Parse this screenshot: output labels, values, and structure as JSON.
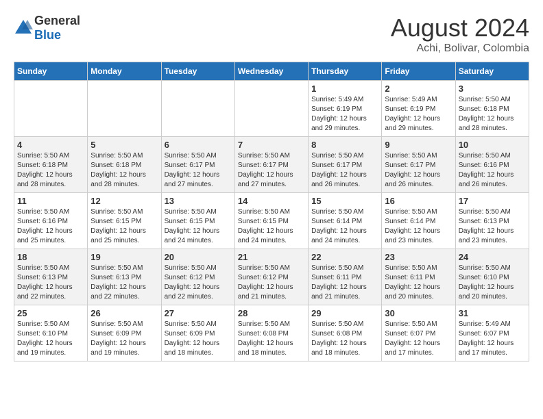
{
  "header": {
    "logo": {
      "general": "General",
      "blue": "Blue"
    },
    "month": "August 2024",
    "location": "Achi, Bolivar, Colombia"
  },
  "weekdays": [
    "Sunday",
    "Monday",
    "Tuesday",
    "Wednesday",
    "Thursday",
    "Friday",
    "Saturday"
  ],
  "weeks": [
    [
      {
        "day": "",
        "info": ""
      },
      {
        "day": "",
        "info": ""
      },
      {
        "day": "",
        "info": ""
      },
      {
        "day": "",
        "info": ""
      },
      {
        "day": "1",
        "info": "Sunrise: 5:49 AM\nSunset: 6:19 PM\nDaylight: 12 hours\nand 29 minutes."
      },
      {
        "day": "2",
        "info": "Sunrise: 5:49 AM\nSunset: 6:19 PM\nDaylight: 12 hours\nand 29 minutes."
      },
      {
        "day": "3",
        "info": "Sunrise: 5:50 AM\nSunset: 6:18 PM\nDaylight: 12 hours\nand 28 minutes."
      }
    ],
    [
      {
        "day": "4",
        "info": "Sunrise: 5:50 AM\nSunset: 6:18 PM\nDaylight: 12 hours\nand 28 minutes."
      },
      {
        "day": "5",
        "info": "Sunrise: 5:50 AM\nSunset: 6:18 PM\nDaylight: 12 hours\nand 28 minutes."
      },
      {
        "day": "6",
        "info": "Sunrise: 5:50 AM\nSunset: 6:17 PM\nDaylight: 12 hours\nand 27 minutes."
      },
      {
        "day": "7",
        "info": "Sunrise: 5:50 AM\nSunset: 6:17 PM\nDaylight: 12 hours\nand 27 minutes."
      },
      {
        "day": "8",
        "info": "Sunrise: 5:50 AM\nSunset: 6:17 PM\nDaylight: 12 hours\nand 26 minutes."
      },
      {
        "day": "9",
        "info": "Sunrise: 5:50 AM\nSunset: 6:17 PM\nDaylight: 12 hours\nand 26 minutes."
      },
      {
        "day": "10",
        "info": "Sunrise: 5:50 AM\nSunset: 6:16 PM\nDaylight: 12 hours\nand 26 minutes."
      }
    ],
    [
      {
        "day": "11",
        "info": "Sunrise: 5:50 AM\nSunset: 6:16 PM\nDaylight: 12 hours\nand 25 minutes."
      },
      {
        "day": "12",
        "info": "Sunrise: 5:50 AM\nSunset: 6:15 PM\nDaylight: 12 hours\nand 25 minutes."
      },
      {
        "day": "13",
        "info": "Sunrise: 5:50 AM\nSunset: 6:15 PM\nDaylight: 12 hours\nand 24 minutes."
      },
      {
        "day": "14",
        "info": "Sunrise: 5:50 AM\nSunset: 6:15 PM\nDaylight: 12 hours\nand 24 minutes."
      },
      {
        "day": "15",
        "info": "Sunrise: 5:50 AM\nSunset: 6:14 PM\nDaylight: 12 hours\nand 24 minutes."
      },
      {
        "day": "16",
        "info": "Sunrise: 5:50 AM\nSunset: 6:14 PM\nDaylight: 12 hours\nand 23 minutes."
      },
      {
        "day": "17",
        "info": "Sunrise: 5:50 AM\nSunset: 6:13 PM\nDaylight: 12 hours\nand 23 minutes."
      }
    ],
    [
      {
        "day": "18",
        "info": "Sunrise: 5:50 AM\nSunset: 6:13 PM\nDaylight: 12 hours\nand 22 minutes."
      },
      {
        "day": "19",
        "info": "Sunrise: 5:50 AM\nSunset: 6:13 PM\nDaylight: 12 hours\nand 22 minutes."
      },
      {
        "day": "20",
        "info": "Sunrise: 5:50 AM\nSunset: 6:12 PM\nDaylight: 12 hours\nand 22 minutes."
      },
      {
        "day": "21",
        "info": "Sunrise: 5:50 AM\nSunset: 6:12 PM\nDaylight: 12 hours\nand 21 minutes."
      },
      {
        "day": "22",
        "info": "Sunrise: 5:50 AM\nSunset: 6:11 PM\nDaylight: 12 hours\nand 21 minutes."
      },
      {
        "day": "23",
        "info": "Sunrise: 5:50 AM\nSunset: 6:11 PM\nDaylight: 12 hours\nand 20 minutes."
      },
      {
        "day": "24",
        "info": "Sunrise: 5:50 AM\nSunset: 6:10 PM\nDaylight: 12 hours\nand 20 minutes."
      }
    ],
    [
      {
        "day": "25",
        "info": "Sunrise: 5:50 AM\nSunset: 6:10 PM\nDaylight: 12 hours\nand 19 minutes."
      },
      {
        "day": "26",
        "info": "Sunrise: 5:50 AM\nSunset: 6:09 PM\nDaylight: 12 hours\nand 19 minutes."
      },
      {
        "day": "27",
        "info": "Sunrise: 5:50 AM\nSunset: 6:09 PM\nDaylight: 12 hours\nand 18 minutes."
      },
      {
        "day": "28",
        "info": "Sunrise: 5:50 AM\nSunset: 6:08 PM\nDaylight: 12 hours\nand 18 minutes."
      },
      {
        "day": "29",
        "info": "Sunrise: 5:50 AM\nSunset: 6:08 PM\nDaylight: 12 hours\nand 18 minutes."
      },
      {
        "day": "30",
        "info": "Sunrise: 5:50 AM\nSunset: 6:07 PM\nDaylight: 12 hours\nand 17 minutes."
      },
      {
        "day": "31",
        "info": "Sunrise: 5:49 AM\nSunset: 6:07 PM\nDaylight: 12 hours\nand 17 minutes."
      }
    ]
  ]
}
